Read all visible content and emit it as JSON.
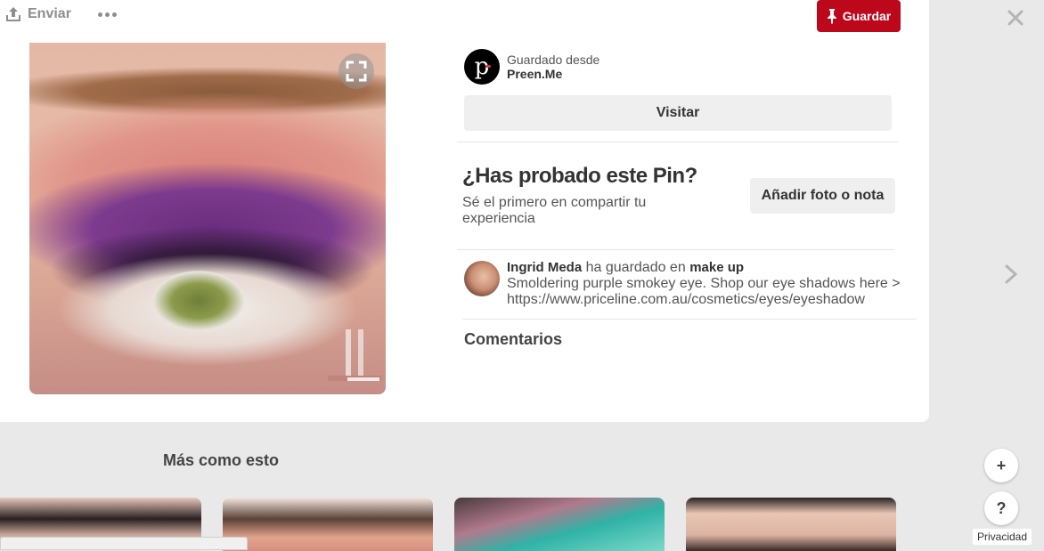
{
  "toolbar": {
    "send_label": "Enviar",
    "save_label": "Guardar",
    "send_icon": "share-upload-icon",
    "more_icon": "ellipsis-icon",
    "save_icon": "pushpin-icon"
  },
  "colors": {
    "brand_red": "#bd081c",
    "button_gray": "#efefef"
  },
  "source": {
    "label": "Guardado desde",
    "name": "Preen.Me",
    "logo_letter": "p"
  },
  "visit_label": "Visitar",
  "tried": {
    "title": "¿Has probado este Pin?",
    "subtitle": "Sé el primero en compartir tu experiencia",
    "add_button": "Añadir foto o nota"
  },
  "activity": {
    "user": "Ingrid Meda",
    "verb": "ha guardado en",
    "board": "make up",
    "description": "Smoldering purple smokey eye. Shop our eye shadows here > https://www.priceline.com.au/cosmetics/eyes/eyeshadow"
  },
  "comments_title": "Comentarios",
  "more_like_title": "Más como esto",
  "floating": {
    "add_label": "+",
    "help_label": "?",
    "privacy_label": "Privacidad"
  }
}
